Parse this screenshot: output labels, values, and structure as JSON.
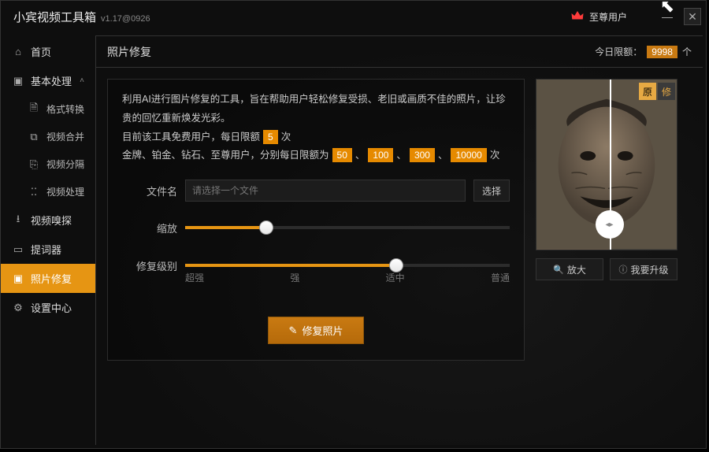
{
  "app": {
    "name": "小宾视频工具箱",
    "version": "v1.17@0926"
  },
  "user": {
    "crown_color": "#ff4d4d",
    "tier_label": "至尊用户"
  },
  "window_controls": {
    "minimize": "—",
    "close": "✕"
  },
  "sidebar": {
    "home": "首页",
    "basic": "基本处理",
    "items": [
      {
        "icon": "doc-icon",
        "label": "格式转换"
      },
      {
        "icon": "merge-icon",
        "label": "视频合并"
      },
      {
        "icon": "split-icon",
        "label": "视频分隔"
      },
      {
        "icon": "fx-icon",
        "label": "视频处理"
      }
    ],
    "sniff": "视频嗅探",
    "prompter": "提词器",
    "photo": "照片修复",
    "settings": "设置中心"
  },
  "header": {
    "page_title": "照片修复",
    "quota_label": "今日限额：",
    "quota_value": "9998",
    "quota_unit": "个"
  },
  "desc": {
    "line1": "利用AI进行图片修复的工具，旨在帮助用户轻松修复受损、老旧或画质不佳的照片，让珍贵的回忆重新焕发光彩。",
    "line2a": "目前该工具免费用户，每日限额",
    "free_limit": "5",
    "line2b": "次",
    "line3a": "金牌、铂金、钻石、至尊用户，分别每日限额为",
    "t1": "50",
    "t2": "100",
    "t3": "300",
    "t4": "10000",
    "line3b": "次",
    "sep": "、"
  },
  "form": {
    "file_label": "文件名",
    "file_placeholder": "请选择一个文件",
    "select_btn": "选择",
    "zoom_label": "缩放",
    "level_label": "修复级别",
    "ticks": {
      "t0": "超强",
      "t1": "强",
      "t2": "适中",
      "t3": "普通"
    },
    "zoom_percent": 25,
    "level_percent": 65,
    "main_btn": "修复照片"
  },
  "preview": {
    "before_tag": "原",
    "after_tag": "修",
    "enlarge": "放大",
    "upgrade": "我要升级"
  }
}
